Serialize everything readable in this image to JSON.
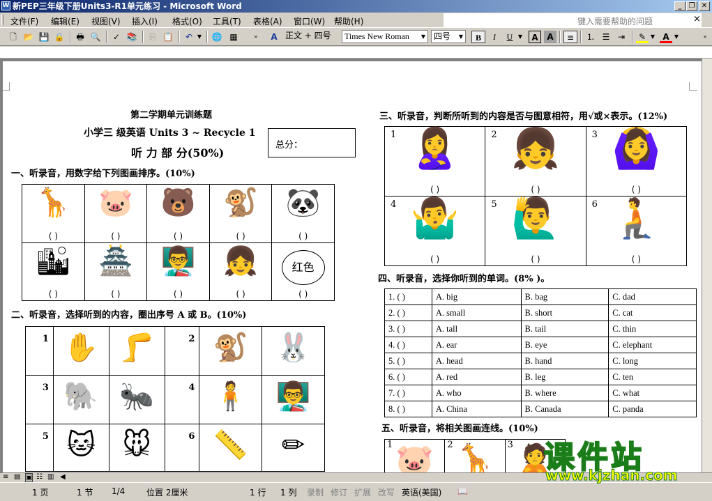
{
  "window": {
    "title": "新PEP三年级下册Units3-R1单元练习 - Microsoft Word",
    "icon": "W"
  },
  "menu": [
    "文件(F)",
    "编辑(E)",
    "视图(V)",
    "插入(I)",
    "格式(O)",
    "工具(T)",
    "表格(A)",
    "窗口(W)",
    "帮助(H)"
  ],
  "help_placeholder": "键入需要帮助的问题",
  "toolbar": {
    "style": "正文 + 四号",
    "font": "Times New Roman",
    "size": "四号",
    "bold": "B",
    "italic": "I",
    "underline": "U"
  },
  "doc": {
    "heading1": "第二学期单元训练题",
    "heading2": "小学三  级英语 Units 3 ~ Recycle 1",
    "heading3": "听 力 部 分(50%)",
    "score_label": "总分：",
    "sec1": "一、听录音，用数字给下列图画排序。(10%)",
    "sec2": "二、听录音，选择听到的内容，圈出序号 A 或 B。(10%)",
    "sec3": "三、听录音，判断所听到的内容是否与图意相符，用√或×表示。(12%)",
    "sec4": "四、听录音，选择你听到的单词。(8%  )。",
    "sec5": "五、听录音，将相关图画连线。(10%)",
    "paren": "(    )",
    "red_label": "红色",
    "sec1_icons": [
      "giraffe-icon",
      "pig-icon",
      "bear-icon",
      "monkey-icon",
      "panda-icon",
      "photo-icon",
      "great-wall-icon",
      "teacher-icon",
      "girl-icon",
      "red-apple-icon"
    ],
    "sec1_glyphs": [
      "🦒",
      "🐷",
      "🐻",
      "🐒",
      "🐼",
      "🏙",
      "🏯",
      "👨‍🏫",
      "👧",
      ""
    ],
    "sec2_rows": [
      {
        "n1": "1",
        "a": "✋",
        "b": "🦵",
        "n2": "2",
        "c": "🐒",
        "d": "🐰"
      },
      {
        "n1": "3",
        "a": "🐘",
        "b": "🐜",
        "n2": "4",
        "c": "🧍",
        "d": "👨‍🏫"
      },
      {
        "n1": "5",
        "a": "🐱",
        "b": "🐭",
        "n2": "6",
        "c": "📏",
        "d": "✏"
      }
    ],
    "sec3_cells": [
      {
        "n": "1",
        "g": "🙎‍♀️"
      },
      {
        "n": "2",
        "g": "👧"
      },
      {
        "n": "3",
        "g": "🙆‍♀️"
      },
      {
        "n": "4",
        "g": "🤷‍♂️"
      },
      {
        "n": "5",
        "g": "🙋‍♂️"
      },
      {
        "n": "6",
        "g": "🧎"
      }
    ],
    "sec4_rows": [
      {
        "n": "1. (     )",
        "a": "A. big",
        "b": "B. bag",
        "c": "C. dad"
      },
      {
        "n": "2. (     )",
        "a": "A. small",
        "b": "B. short",
        "c": "C. cat"
      },
      {
        "n": "3. (     )",
        "a": "A. tall",
        "b": "B. tail",
        "c": "C. thin"
      },
      {
        "n": "4. (     )",
        "a": "A. ear",
        "b": "B. eye",
        "c": "C. elephant"
      },
      {
        "n": "5. (     )",
        "a": "A. head",
        "b": "B. hand",
        "c": "C. long"
      },
      {
        "n": "6. (     )",
        "a": "A. red",
        "b": "B. leg",
        "c": "C. ten"
      },
      {
        "n": "7. (     )",
        "a": "A. who",
        "b": "B. where",
        "c": "C. what"
      },
      {
        "n": "8. (     )",
        "a": "A. China",
        "b": "B. Canada",
        "c": "C. panda"
      }
    ],
    "sec5_cells": [
      {
        "n": "1",
        "g": "🐷"
      },
      {
        "n": "2",
        "g": "🦒"
      },
      {
        "n": "3",
        "g": "🙎"
      }
    ]
  },
  "status": {
    "page": "1 页",
    "section": "1 节",
    "pages": "1/4",
    "position": "位置 2厘米",
    "line": "1 行",
    "col": "1 列",
    "rec": "录制",
    "trk": "修订",
    "ext": "扩展",
    "ovr": "改写",
    "lang": "英语(美国)"
  },
  "watermark": {
    "brand": "课件站",
    "url": "www.kjzhan.com"
  }
}
